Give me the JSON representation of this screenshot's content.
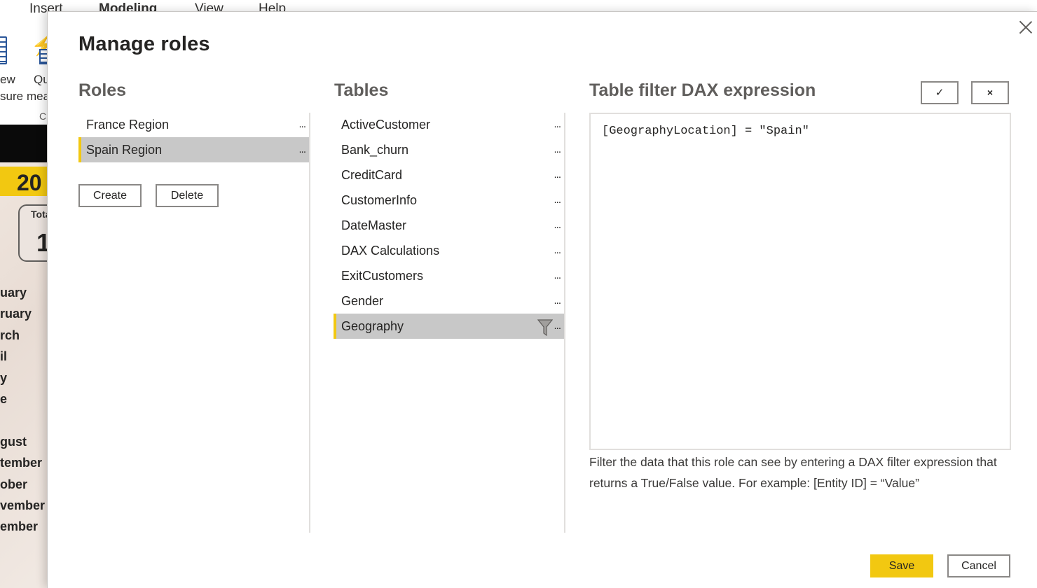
{
  "background": {
    "ribbon_tabs": [
      "Insert",
      "Modeling",
      "View",
      "Help"
    ],
    "ribbon_labels": {
      "new_measure_line1": "ew",
      "new_measure_line2": "sure",
      "quick_line1": "Qu",
      "quick_line2": "mea",
      "group": "C"
    },
    "year_label": "20",
    "card_label": "Tota",
    "card_value": "1",
    "months": [
      "uary",
      "ruary",
      "rch",
      "il",
      "y",
      "e",
      "",
      "gust",
      "tember",
      "ober",
      "vember",
      "ember"
    ]
  },
  "dialog": {
    "title": "Manage roles",
    "roles_heading": "Roles",
    "tables_heading": "Tables",
    "dax_heading": "Table filter DAX expression",
    "more_glyph": "...",
    "roles": [
      {
        "label": "France Region",
        "selected": false
      },
      {
        "label": "Spain Region",
        "selected": true
      }
    ],
    "create_label": "Create",
    "delete_label": "Delete",
    "tables": [
      {
        "label": "ActiveCustomer",
        "selected": false
      },
      {
        "label": "Bank_churn",
        "selected": false
      },
      {
        "label": "CreditCard",
        "selected": false
      },
      {
        "label": "CustomerInfo",
        "selected": false
      },
      {
        "label": "DateMaster",
        "selected": false
      },
      {
        "label": "DAX Calculations",
        "selected": false
      },
      {
        "label": "ExitCustomers",
        "selected": false
      },
      {
        "label": "Gender",
        "selected": false
      },
      {
        "label": "Geography",
        "selected": true,
        "filtered": true
      }
    ],
    "check_glyph": "✓",
    "cancel_expr_glyph": "×",
    "dax_expression": "[GeographyLocation] = \"Spain\"",
    "help_text": "Filter the data that this role can see by entering a DAX filter expression that returns a True/False value. For example: [Entity ID] = “Value”",
    "save_label": "Save",
    "cancel_label": "Cancel"
  },
  "colors": {
    "accent_yellow": "#f2c811",
    "selected_bg": "#c8c8c8",
    "divider": "#e1dfdd"
  }
}
